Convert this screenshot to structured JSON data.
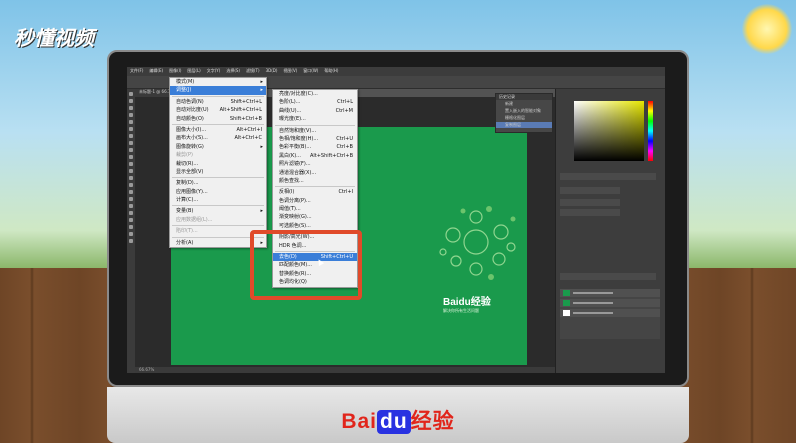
{
  "brand_logo": "秒懂视频",
  "monitor_brand": {
    "bai": "Bai",
    "du": "du",
    "cn": "经验"
  },
  "ps": {
    "menubar": [
      "文件(F)",
      "编辑(E)",
      "图像(I)",
      "图层(L)",
      "文字(Y)",
      "选择(S)",
      "滤镜(T)",
      "3D(D)",
      "视图(V)",
      "窗口(W)",
      "帮助(H)"
    ],
    "tab": "未标题-1 @ 66.7%",
    "status": "66.67%"
  },
  "history_panel": {
    "title": "历史记录",
    "items": [
      "新建",
      "置入嵌入的智能对象",
      "栅格化图层",
      "复制图层"
    ]
  },
  "canvas": {
    "brand": "Baidu经验",
    "slogan": "解决你所有生活问题"
  },
  "image_menu": {
    "items": [
      {
        "label": "模式(M)",
        "shortcut": "",
        "arrow": true
      },
      {
        "label": "调整(J)",
        "shortcut": "",
        "arrow": true,
        "highlighted": true
      },
      {
        "sep": true
      },
      {
        "label": "自动色调(N)",
        "shortcut": "Shift+Ctrl+L"
      },
      {
        "label": "自动对比度(U)",
        "shortcut": "Alt+Shift+Ctrl+L"
      },
      {
        "label": "自动颜色(O)",
        "shortcut": "Shift+Ctrl+B"
      },
      {
        "sep": true
      },
      {
        "label": "图像大小(I)...",
        "shortcut": "Alt+Ctrl+I"
      },
      {
        "label": "画布大小(S)...",
        "shortcut": "Alt+Ctrl+C"
      },
      {
        "label": "图像旋转(G)",
        "shortcut": "",
        "arrow": true
      },
      {
        "label": "裁剪(P)",
        "shortcut": "",
        "disabled": true
      },
      {
        "label": "裁切(R)...",
        "shortcut": ""
      },
      {
        "label": "显示全部(V)",
        "shortcut": ""
      },
      {
        "sep": true
      },
      {
        "label": "复制(D)...",
        "shortcut": ""
      },
      {
        "label": "应用图像(Y)...",
        "shortcut": ""
      },
      {
        "label": "计算(C)...",
        "shortcut": ""
      },
      {
        "sep": true
      },
      {
        "label": "变量(B)",
        "shortcut": "",
        "arrow": true
      },
      {
        "label": "应用数据组(L)...",
        "shortcut": "",
        "disabled": true
      },
      {
        "sep": true
      },
      {
        "label": "陷印(T)...",
        "shortcut": "",
        "disabled": true
      },
      {
        "sep": true
      },
      {
        "label": "分析(A)",
        "shortcut": "",
        "arrow": true
      }
    ]
  },
  "adjust_menu": {
    "items": [
      {
        "label": "亮度/对比度(C)...",
        "shortcut": ""
      },
      {
        "label": "色阶(L)...",
        "shortcut": "Ctrl+L"
      },
      {
        "label": "曲线(U)...",
        "shortcut": "Ctrl+M"
      },
      {
        "label": "曝光度(E)...",
        "shortcut": ""
      },
      {
        "sep": true
      },
      {
        "label": "自然饱和度(V)...",
        "shortcut": ""
      },
      {
        "label": "色相/饱和度(H)...",
        "shortcut": "Ctrl+U"
      },
      {
        "label": "色彩平衡(B)...",
        "shortcut": "Ctrl+B"
      },
      {
        "label": "黑白(K)...",
        "shortcut": "Alt+Shift+Ctrl+B"
      },
      {
        "label": "照片滤镜(F)...",
        "shortcut": ""
      },
      {
        "label": "通道混合器(X)...",
        "shortcut": ""
      },
      {
        "label": "颜色查找...",
        "shortcut": ""
      },
      {
        "sep": true
      },
      {
        "label": "反相(I)",
        "shortcut": "Ctrl+I"
      },
      {
        "label": "色调分离(P)...",
        "shortcut": ""
      },
      {
        "label": "阈值(T)...",
        "shortcut": ""
      },
      {
        "label": "渐变映射(G)...",
        "shortcut": ""
      },
      {
        "label": "可选颜色(S)...",
        "shortcut": ""
      },
      {
        "sep": true
      },
      {
        "label": "阴影/高光(W)...",
        "shortcut": ""
      },
      {
        "label": "HDR 色调...",
        "shortcut": ""
      },
      {
        "sep": true
      },
      {
        "label": "去色(D)",
        "shortcut": "Shift+Ctrl+U",
        "highlighted": true
      },
      {
        "label": "匹配颜色(M)...",
        "shortcut": ""
      },
      {
        "label": "替换颜色(R)...",
        "shortcut": ""
      },
      {
        "label": "色调均化(Q)",
        "shortcut": ""
      }
    ]
  },
  "colors": {
    "accent": "#3a7ed8",
    "canvas": "#1a9a4c",
    "highlight_box": "#e04a2a"
  }
}
